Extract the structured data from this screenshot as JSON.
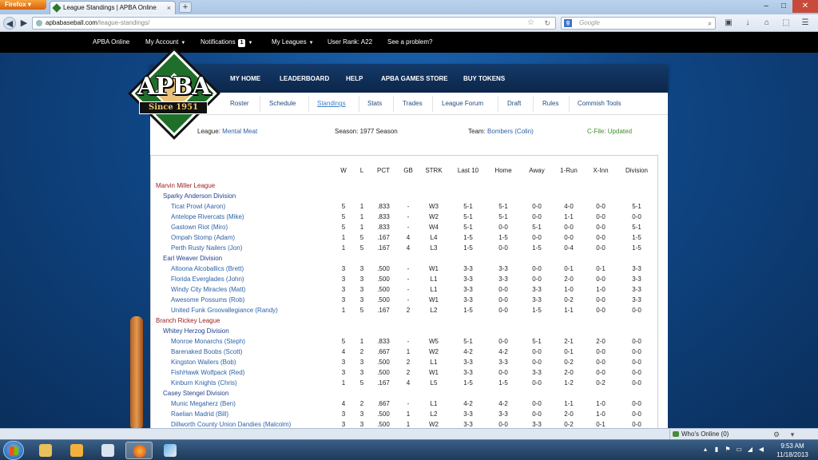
{
  "browser": {
    "firefox_label": "Firefox",
    "tab_title": "League Standings | APBA Online",
    "tab_close": "×",
    "new_tab": "+",
    "url_domain": "apbabaseball.com",
    "url_path": "/league-standings/",
    "search_placeholder": "Google",
    "icons": [
      "back-icon",
      "forward-icon",
      "star-icon",
      "reload-icon",
      "google-icon",
      "search-icon",
      "screenshot-icon",
      "download-icon",
      "home-icon",
      "menu-icon"
    ]
  },
  "site_nav": {
    "brand": "APBA Online",
    "my_account": "My Account",
    "notifications": "Notifications",
    "notifications_count": "1",
    "my_leagues": "My Leagues",
    "user_rank": "User Rank: A22",
    "problem": "See a problem?"
  },
  "logo": {
    "word": "APBA",
    "since": "Since 1951"
  },
  "main_nav": [
    "MY HOME",
    "LEADERBOARD",
    "HELP",
    "APBA GAMES STORE",
    "BUY TOKENS"
  ],
  "sub_nav": [
    "Roster",
    "Schedule",
    "Standings",
    "Stats",
    "Trades",
    "League Forum",
    "Draft",
    "Rules",
    "Commish Tools"
  ],
  "active_sub_nav": "Standings",
  "info": {
    "league_label": "League:",
    "league_value": "Mental Meat",
    "season_label": "Season: 1977 Season",
    "team_label": "Team:",
    "team_value": "Bombers (Colin)",
    "cfile": "C-File: Updated"
  },
  "standings": {
    "columns": [
      "W",
      "L",
      "PCT",
      "GB",
      "STRK",
      "Last 10",
      "Home",
      "Away",
      "1-Run",
      "X-Inn",
      "Division"
    ],
    "leagues": [
      {
        "name": "Marvin Miller League",
        "divisions": [
          {
            "name": "Sparky Anderson Division",
            "teams": [
              [
                "Ticat Prowl (Aaron)",
                "5",
                "1",
                ".833",
                "-",
                "W3",
                "5-1",
                "5-1",
                "0-0",
                "4-0",
                "0-0",
                "5-1"
              ],
              [
                "Antelope Rivercats (Mike)",
                "5",
                "1",
                ".833",
                "-",
                "W2",
                "5-1",
                "5-1",
                "0-0",
                "1-1",
                "0-0",
                "0-0"
              ],
              [
                "Gastown Riot (Miro)",
                "5",
                "1",
                ".833",
                "-",
                "W4",
                "5-1",
                "0-0",
                "5-1",
                "0-0",
                "0-0",
                "5-1"
              ],
              [
                "Ompah Stomp (Adam)",
                "1",
                "5",
                ".167",
                "4",
                "L4",
                "1-5",
                "1-5",
                "0-0",
                "0-0",
                "0-0",
                "1-5"
              ],
              [
                "Perth Rusty Nailers (Jon)",
                "1",
                "5",
                ".167",
                "4",
                "L3",
                "1-5",
                "0-0",
                "1-5",
                "0-4",
                "0-0",
                "1-5"
              ]
            ]
          },
          {
            "name": "Earl Weaver Division",
            "teams": [
              [
                "Altoona Alcoballics (Brett)",
                "3",
                "3",
                ".500",
                "-",
                "W1",
                "3-3",
                "3-3",
                "0-0",
                "0-1",
                "0-1",
                "3-3"
              ],
              [
                "Florida Everglades (John)",
                "3",
                "3",
                ".500",
                "-",
                "L1",
                "3-3",
                "3-3",
                "0-0",
                "2-0",
                "0-0",
                "3-3"
              ],
              [
                "Windy City Miracles (Matt)",
                "3",
                "3",
                ".500",
                "-",
                "L1",
                "3-3",
                "0-0",
                "3-3",
                "1-0",
                "1-0",
                "3-3"
              ],
              [
                "Awesome Possums (Rob)",
                "3",
                "3",
                ".500",
                "-",
                "W1",
                "3-3",
                "0-0",
                "3-3",
                "0-2",
                "0-0",
                "3-3"
              ],
              [
                "United Funk Groovallegiance (Randy)",
                "1",
                "5",
                ".167",
                "2",
                "L2",
                "1-5",
                "0-0",
                "1-5",
                "1-1",
                "0-0",
                "0-0"
              ]
            ]
          }
        ]
      },
      {
        "name": "Branch Rickey League",
        "divisions": [
          {
            "name": "Whitey Herzog Division",
            "teams": [
              [
                "Monroe Monarchs (Steph)",
                "5",
                "1",
                ".833",
                "-",
                "W5",
                "5-1",
                "0-0",
                "5-1",
                "2-1",
                "2-0",
                "0-0"
              ],
              [
                "Barenaked Boobs (Scott)",
                "4",
                "2",
                ".667",
                "1",
                "W2",
                "4-2",
                "4-2",
                "0-0",
                "0-1",
                "0-0",
                "0-0"
              ],
              [
                "Kingston Wailers (Bob)",
                "3",
                "3",
                ".500",
                "2",
                "L1",
                "3-3",
                "3-3",
                "0-0",
                "0-2",
                "0-0",
                "0-0"
              ],
              [
                "FishHawk Wolfpack (Red)",
                "3",
                "3",
                ".500",
                "2",
                "W1",
                "3-3",
                "0-0",
                "3-3",
                "2-0",
                "0-0",
                "0-0"
              ],
              [
                "Kinburn Knights (Chris)",
                "1",
                "5",
                ".167",
                "4",
                "L5",
                "1-5",
                "1-5",
                "0-0",
                "1-2",
                "0-2",
                "0-0"
              ]
            ]
          },
          {
            "name": "Casey Stengel Division",
            "teams": [
              [
                "Munic Megaherz (Ben)",
                "4",
                "2",
                ".667",
                "-",
                "L1",
                "4-2",
                "4-2",
                "0-0",
                "1-1",
                "1-0",
                "0-0"
              ],
              [
                "Raelian Madrid (Bill)",
                "3",
                "3",
                ".500",
                "1",
                "L2",
                "3-3",
                "3-3",
                "0-0",
                "2-0",
                "1-0",
                "0-0"
              ],
              [
                "Dillworth County Union Dandies (Malcolm)",
                "3",
                "3",
                ".500",
                "1",
                "W2",
                "3-3",
                "0-0",
                "3-3",
                "0-2",
                "0-1",
                "0-0"
              ]
            ]
          }
        ]
      }
    ]
  },
  "bottom": {
    "whos_online": "Who's Online (0)"
  },
  "taskbar": {
    "time": "9:53 AM",
    "date": "11/18/2013",
    "apps": [
      "file-explorer-icon",
      "mail-icon",
      "notepad-icon",
      "firefox-icon",
      "paint-icon"
    ]
  }
}
